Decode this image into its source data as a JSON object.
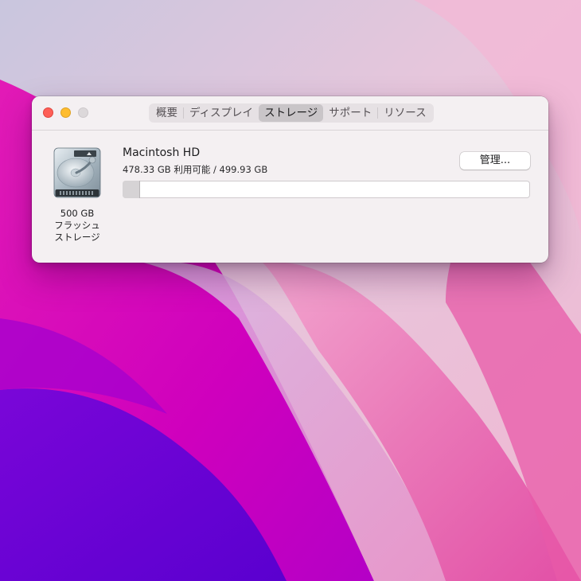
{
  "desktop": {
    "wallpaper": "macOS Monterey",
    "colors": {
      "magenta": "#d400b0",
      "purple": "#6f00d8",
      "pink": "#ee6fb0",
      "lavender": "#c4b3dc"
    }
  },
  "window": {
    "traffic_lights": [
      {
        "name": "close",
        "color": "#fe5f57"
      },
      {
        "name": "minimize",
        "color": "#febc2e"
      },
      {
        "name": "zoom",
        "color": "#dcd8da",
        "enabled": false
      }
    ],
    "tabs": [
      {
        "label": "概要",
        "active": false
      },
      {
        "label": "ディスプレイ",
        "active": false
      },
      {
        "label": "ストレージ",
        "active": true
      },
      {
        "label": "サポート",
        "active": false
      },
      {
        "label": "リソース",
        "active": false
      }
    ]
  },
  "storage": {
    "disk": {
      "icon": "hard-drive-icon",
      "capacity_label": "500 GB",
      "type_line1": "フラッシュ",
      "type_line2": "ストレージ"
    },
    "volume_name": "Macintosh HD",
    "usage_text": "478.33 GB 利用可能 / 499.93 GB",
    "used_fraction": 0.043,
    "manage_button": "管理..."
  }
}
